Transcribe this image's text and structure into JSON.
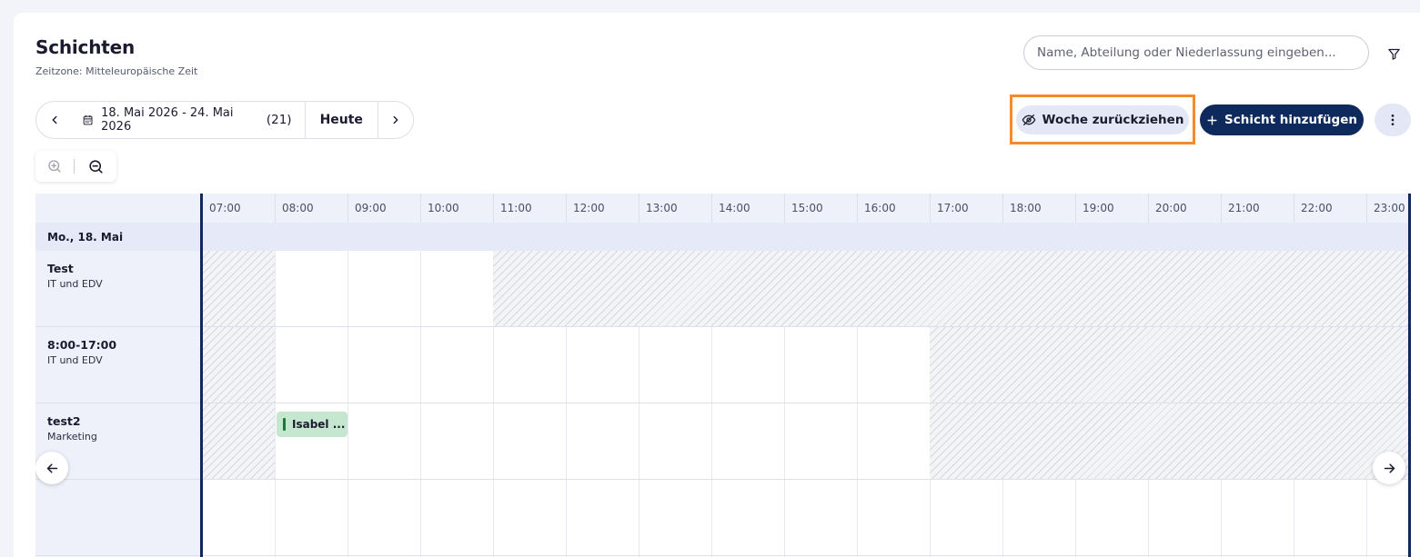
{
  "header": {
    "title": "Schichten",
    "timezone": "Zeitzone: Mitteleuropäische Zeit"
  },
  "search": {
    "placeholder": "Name, Abteilung oder Niederlassung eingeben..."
  },
  "date_nav": {
    "range": "18. Mai 2026 - 24. Mai 2026",
    "count": "(21)",
    "today_label": "Heute"
  },
  "actions": {
    "retract_week_label": "Woche zurückziehen",
    "add_shift_label": "Schicht hinzufügen"
  },
  "colors": {
    "primary": "#0e2a5c",
    "highlight": "#f28a2e",
    "chip": "#c5e6cf",
    "chip_bar": "#1b7a3a"
  },
  "timeline": {
    "hours": [
      "07:00",
      "08:00",
      "09:00",
      "10:00",
      "11:00",
      "12:00",
      "13:00",
      "14:00",
      "15:00",
      "16:00",
      "17:00",
      "18:00",
      "19:00",
      "20:00",
      "21:00",
      "22:00",
      "23:00"
    ],
    "day_label": "Mo.,  18. Mai"
  },
  "shifts": [
    {
      "name": "Test",
      "department": "IT und EDV"
    },
    {
      "name": "8:00-17:00",
      "department": "IT und EDV"
    },
    {
      "name": "test2",
      "department": "Marketing",
      "assignment": "Isabel ..."
    }
  ],
  "icons": {
    "filter": "filter-icon",
    "calendar": "calendar-icon",
    "retract": "eye-off-icon",
    "add": "plus-icon",
    "more": "more-vertical-icon",
    "zoom_in": "zoom-in-icon",
    "zoom_out": "zoom-out-icon"
  }
}
